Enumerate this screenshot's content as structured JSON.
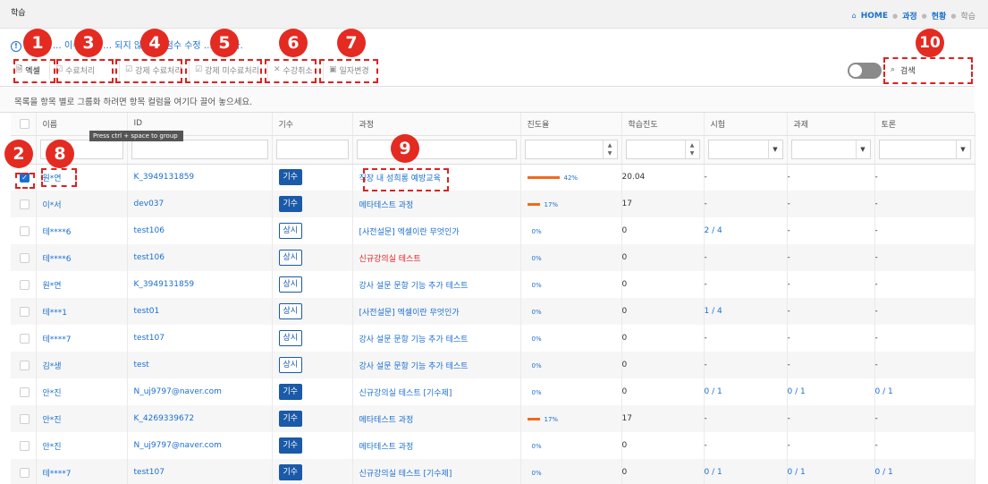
{
  "titlebar": {
    "title": "학습"
  },
  "breadcrumb": {
    "home": "HOME",
    "course": "과정",
    "status": "현황",
    "current": "학습"
  },
  "notice": {
    "text": "빨간색 … 이수 기준 … 되지 않아 … 점수 수정 … 합니다."
  },
  "toolbar": {
    "buttons": [
      {
        "label": "엑셀",
        "icon": "excel-icon"
      },
      {
        "label": "수료처리",
        "icon": "check-icon"
      },
      {
        "label": "강제 수료처리",
        "icon": "check-icon"
      },
      {
        "label": "강제 미수료처리",
        "icon": "check-icon"
      },
      {
        "label": "수강취소",
        "icon": "close-icon"
      },
      {
        "label": "일자변경",
        "icon": "calendar-icon"
      }
    ]
  },
  "search": {
    "label": "검색"
  },
  "group_hint": "목록을 항목 별로 그룹화 하려면 항목 컬럼을 여기다 끌어 놓으세요.",
  "tooltip": "Press ctrl + space to group",
  "columns": {
    "name": "이름",
    "id": "ID",
    "gisu": "기수",
    "course": "과정",
    "progress": "진도율",
    "study": "학습진도",
    "exam": "시험",
    "task": "과제",
    "discussion": "토론"
  },
  "rows": [
    {
      "checked": true,
      "name": "원*연",
      "id": "K_3949131859",
      "gisu": "기수",
      "gisu_type": "fill",
      "course": "직장 내 성희롱 예방교육",
      "course_red": false,
      "progress": 42,
      "progress_label": "42%",
      "study": "20.04",
      "exam": "-",
      "task": "-",
      "discussion": "-"
    },
    {
      "checked": false,
      "name": "이*서",
      "id": "dev037",
      "gisu": "기수",
      "gisu_type": "fill",
      "course": "메타테스트 과정",
      "course_red": false,
      "progress": 17,
      "progress_label": "17%",
      "study": "17",
      "exam": "-",
      "task": "-",
      "discussion": "-"
    },
    {
      "checked": false,
      "name": "테****6",
      "id": "test106",
      "gisu": "상시",
      "gisu_type": "out",
      "course": "[사전설문] 엑셀이란 무엇인가",
      "course_red": false,
      "progress": 0,
      "progress_label": "0%",
      "study": "0",
      "exam": "2 / 4",
      "task": "-",
      "discussion": "-"
    },
    {
      "checked": false,
      "name": "테****6",
      "id": "test106",
      "gisu": "상시",
      "gisu_type": "out",
      "course": "신규강의실 테스트",
      "course_red": true,
      "progress": 0,
      "progress_label": "0%",
      "study": "0",
      "exam": "-",
      "task": "-",
      "discussion": "-"
    },
    {
      "checked": false,
      "name": "원*연",
      "id": "K_3949131859",
      "gisu": "상시",
      "gisu_type": "out",
      "course": "강사 설문 문항 기능 추가 테스트",
      "course_red": false,
      "progress": 0,
      "progress_label": "0%",
      "study": "0",
      "exam": "-",
      "task": "-",
      "discussion": "-"
    },
    {
      "checked": false,
      "name": "테***1",
      "id": "test01",
      "gisu": "상시",
      "gisu_type": "out",
      "course": "[사전설문] 엑셀이란 무엇인가",
      "course_red": false,
      "progress": 0,
      "progress_label": "0%",
      "study": "0",
      "exam": "1 / 4",
      "task": "-",
      "discussion": "-"
    },
    {
      "checked": false,
      "name": "테****7",
      "id": "test107",
      "gisu": "상시",
      "gisu_type": "out",
      "course": "강사 설문 문항 기능 추가 테스트",
      "course_red": false,
      "progress": 0,
      "progress_label": "0%",
      "study": "0",
      "exam": "-",
      "task": "-",
      "discussion": "-"
    },
    {
      "checked": false,
      "name": "김*생",
      "id": "test",
      "gisu": "상시",
      "gisu_type": "out",
      "course": "강사 설문 문항 기능 추가 테스트",
      "course_red": false,
      "progress": 0,
      "progress_label": "0%",
      "study": "0",
      "exam": "-",
      "task": "-",
      "discussion": "-"
    },
    {
      "checked": false,
      "name": "안*진",
      "id": "N_uj9797@naver.com",
      "gisu": "기수",
      "gisu_type": "fill",
      "course": "신규강의실 테스트 [기수제]",
      "course_red": false,
      "progress": 0,
      "progress_label": "0%",
      "study": "0",
      "exam": "0 / 1",
      "task": "0 / 1",
      "discussion": "0 / 1"
    },
    {
      "checked": false,
      "name": "안*진",
      "id": "K_4269339672",
      "gisu": "기수",
      "gisu_type": "fill",
      "course": "메타테스트 과정",
      "course_red": false,
      "progress": 17,
      "progress_label": "17%",
      "study": "17",
      "exam": "-",
      "task": "-",
      "discussion": "-"
    },
    {
      "checked": false,
      "name": "안*진",
      "id": "N_uj9797@naver.com",
      "gisu": "기수",
      "gisu_type": "fill",
      "course": "메타테스트 과정",
      "course_red": false,
      "progress": 0,
      "progress_label": "0%",
      "study": "0",
      "exam": "-",
      "task": "-",
      "discussion": "-"
    },
    {
      "checked": false,
      "name": "테****7",
      "id": "test107",
      "gisu": "기수",
      "gisu_type": "fill",
      "course": "신규강의실 테스트 [기수제]",
      "course_red": false,
      "progress": 0,
      "progress_label": "0%",
      "study": "0",
      "exam": "0 / 1",
      "task": "0 / 1",
      "discussion": "0 / 1"
    }
  ],
  "annotations": [
    "1",
    "2",
    "3",
    "4",
    "5",
    "6",
    "7",
    "8",
    "9",
    "10"
  ],
  "colors": {
    "accent": "#1a6fd1",
    "annotation_red": "#e32b22",
    "progress_orange": "#f06a1d",
    "tag_blue": "#1a5aa8"
  }
}
